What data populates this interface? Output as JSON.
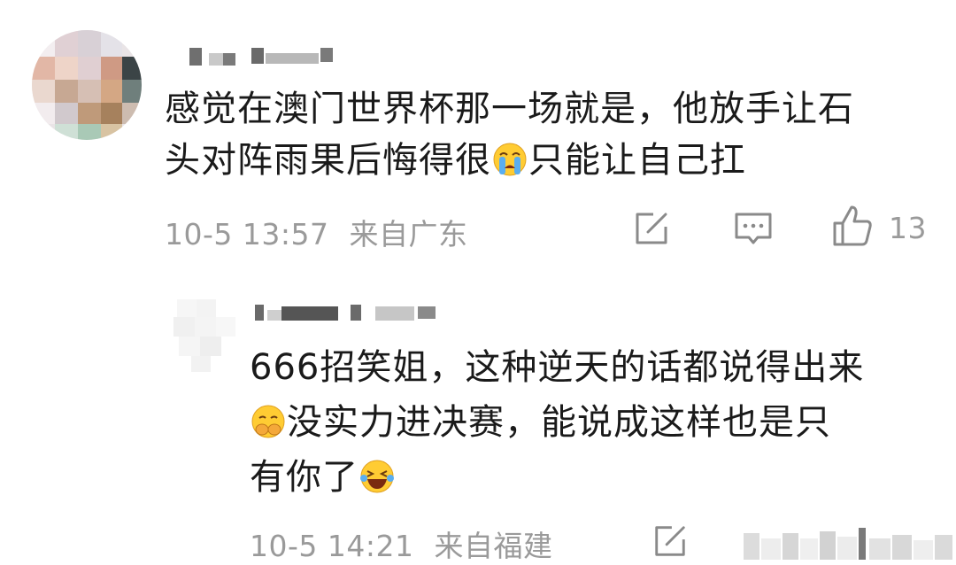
{
  "comments": [
    {
      "text_line1": "感觉在澳门世界杯那一场就是，他放手让石",
      "text_line2_a": "头对阵雨果后悔得很",
      "emoji_1": "crying-face",
      "text_line2_b": "只能让自己扛",
      "timestamp": "10-5 13:57",
      "location": "来自广东",
      "like_count": "13"
    },
    {
      "text_line1": "666招笑姐，这种逆天的话都说得出来",
      "emoji_1": "covering-mouth-face",
      "text_line2": "没实力进决赛，能说成这样也是只",
      "text_line3": "有你了",
      "emoji_2": "laughing-tears-face",
      "timestamp": "10-5 14:21",
      "location": "来自福建"
    }
  ],
  "colors": {
    "text": "#1a1a1a",
    "meta": "#9a9a9a",
    "icon": "#8a8a8a"
  }
}
